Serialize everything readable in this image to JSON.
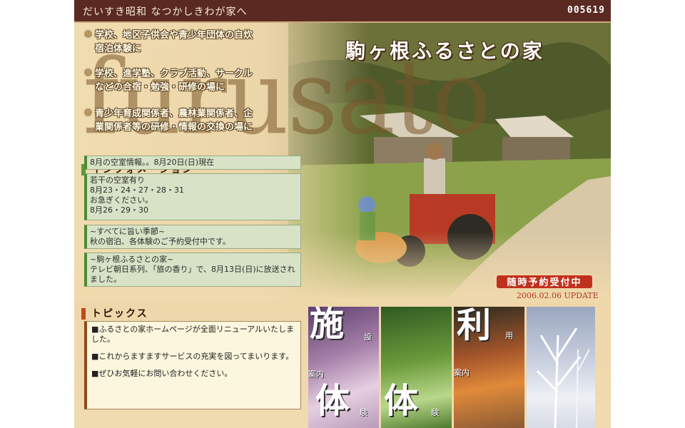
{
  "header": {
    "tagline": "だいすき昭和 なつかしきわが家へ",
    "counter": "005619"
  },
  "hero": {
    "background_word": "furusato",
    "site_title": "駒ヶ根ふるさとの家",
    "purposes": [
      {
        "line1": "学校、地区子供会や青少年団体の自炊",
        "line2": "宿泊体験に"
      },
      {
        "line1": "学校、進学塾、クラブ活動、サークル",
        "line2": "などの合宿・勉強・研修の場に"
      },
      {
        "line1": "青少年育成関係者、農林業関係者、企",
        "line2": "業関係者等の研修・情報の交換の場に"
      }
    ]
  },
  "info": {
    "heading": "インフォメーション",
    "vacancy_notice": "8月の空室情報。。8月20日(日)現在",
    "vacancy_details": [
      "若干の空室有り",
      "8月23・24・27・28・31",
      "お急ぎください。",
      "8月26・29・30"
    ],
    "season": [
      "~すべてに旨い季節~",
      "秋の宿泊、各体験のご予約受付中です。"
    ],
    "tv": [
      "~駒ヶ根ふるさとの家~",
      "テレビ朝日系列、「旅の香り」で、8月13日(日)に放送され",
      "ました。"
    ]
  },
  "reserve_button": "随時予約受付中",
  "update": "2006.02.06 UPDATE",
  "topics": {
    "heading": "トピックス",
    "items": [
      "■ふるさとの家ホームページが全面リニューアルいたしました。",
      "■これからますますサービスの充実を図ってまいります。",
      "■ぜひお気軽にお問い合わせください。"
    ]
  },
  "tiles": [
    {
      "big1": "施",
      "small1": "設",
      "small2": "案内",
      "big2": "体",
      "small3": "験"
    },
    {
      "big1": "",
      "small1": "",
      "small2": "",
      "big2": "体",
      "small3": "験"
    },
    {
      "big1": "利",
      "small1": "用",
      "small2": "案内",
      "big2": "",
      "small3": ""
    },
    {
      "big1": "",
      "small1": "",
      "small2": "",
      "big2": "",
      "small3": ""
    }
  ],
  "colors": {
    "header_bg": "#5a2a22",
    "accent_red": "#c0311d",
    "info_green": "#4d8a35"
  }
}
